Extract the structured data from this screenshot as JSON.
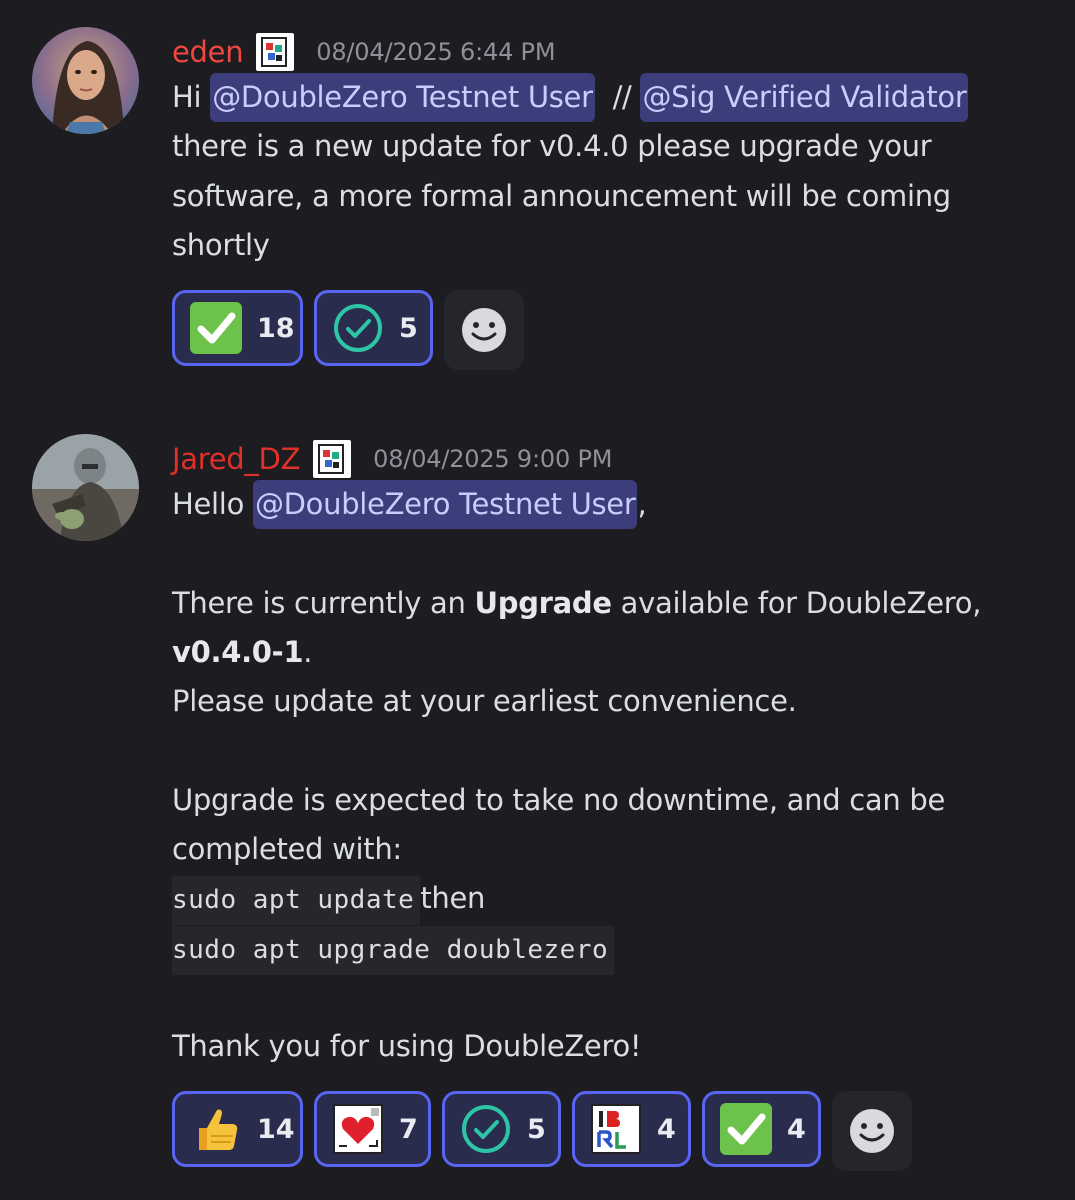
{
  "messages": [
    {
      "username": "eden",
      "username_color": "#f0473e",
      "badge_icon": "app-badge-icon",
      "timestamp": "08/04/2025 6:44 PM",
      "lines": {
        "l1_pre": "Hi ",
        "mention1": "@DoubleZero Testnet User",
        "l1_sep": "  // ",
        "mention2": "@Sig Verified Validator",
        "l2": "there is a new update for v0.4.0 please upgrade your",
        "l3": "software, a more formal announcement will be coming",
        "l4": "shortly"
      },
      "reactions": [
        {
          "emoji": "white-check-mark-emoji",
          "count": "18"
        },
        {
          "emoji": "circle-check-emoji",
          "count": "5"
        }
      ]
    },
    {
      "username": "Jared_DZ",
      "username_color": "#e0302a",
      "badge_icon": "app-badge-icon",
      "timestamp": "08/04/2025 9:00 PM",
      "lines": {
        "l1_pre": "Hello ",
        "mention1": "@DoubleZero Testnet User",
        "l1_post": ",",
        "l3_pre": "There is currently an ",
        "l3_bold": "Upgrade",
        "l3_post": " available for DoubleZero,",
        "l4_bold": "v0.4.0-1",
        "l4_post": ".",
        "l5": "Please update at your earliest convenience.",
        "l7": "Upgrade is expected to take no downtime, and can be",
        "l8": "completed with:",
        "code1": "sudo apt update",
        "l9_post": "then",
        "code2": "sudo apt upgrade doublezero",
        "l12": "Thank you for using DoubleZero!"
      },
      "reactions": [
        {
          "emoji": "thumbs-up-emoji",
          "count": "14"
        },
        {
          "emoji": "heart-card-emoji",
          "count": "7"
        },
        {
          "emoji": "circle-check-emoji",
          "count": "5"
        },
        {
          "emoji": "ibrl-emoji",
          "count": "4"
        },
        {
          "emoji": "white-check-mark-emoji",
          "count": "4"
        }
      ]
    }
  ]
}
